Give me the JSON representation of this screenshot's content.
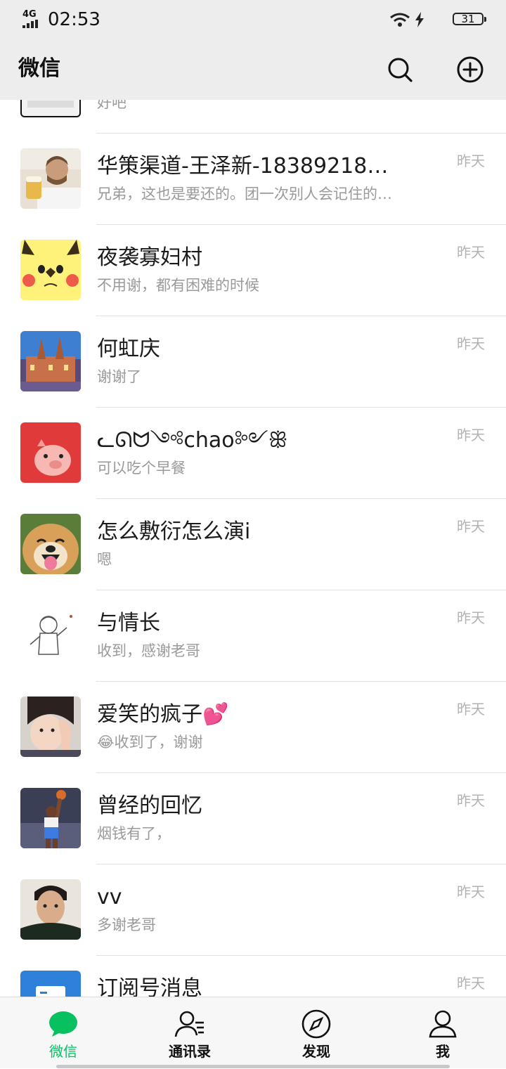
{
  "status_bar": {
    "network": "4G",
    "time": "02:53",
    "battery": "31"
  },
  "header": {
    "title": "微信"
  },
  "chats": [
    {
      "name": "",
      "preview": "好吧",
      "time": ""
    },
    {
      "name": "华策渠道-王泽新-18389218…",
      "preview": "兄弟，这也是要还的。团一次别人会记住的…",
      "time": "昨天"
    },
    {
      "name": "夜袭寡妇村",
      "preview": "不用谢，都有困难的时候",
      "time": "昨天"
    },
    {
      "name": "何虹庆",
      "preview": "谢谢了",
      "time": "昨天"
    },
    {
      "name": "ᓚᘏᗢ༺chao༻ꕥ",
      "preview": "可以吃个早餐",
      "time": "昨天"
    },
    {
      "name": "怎么敷衍怎么演i",
      "preview": "嗯",
      "time": "昨天"
    },
    {
      "name": "与情长",
      "preview": "收到，感谢老哥",
      "time": "昨天"
    },
    {
      "name": "爱笑的疯子💕",
      "preview": "😂收到了，谢谢",
      "time": "昨天"
    },
    {
      "name": "曾经的回忆",
      "preview": "烟钱有了，",
      "time": "昨天"
    },
    {
      "name": "vv",
      "preview": "多谢老哥",
      "time": "昨天"
    },
    {
      "name": "订阅号消息",
      "preview": "",
      "time": "昨天"
    }
  ],
  "tabs": [
    {
      "label": "微信",
      "icon": "chat-bubble-icon",
      "active": true
    },
    {
      "label": "通讯录",
      "icon": "contacts-icon",
      "active": false
    },
    {
      "label": "发现",
      "icon": "compass-icon",
      "active": false
    },
    {
      "label": "我",
      "icon": "person-icon",
      "active": false
    }
  ],
  "colors": {
    "accent": "#07c160",
    "header_bg": "#ededed",
    "preview_text": "#9a9a9a"
  }
}
